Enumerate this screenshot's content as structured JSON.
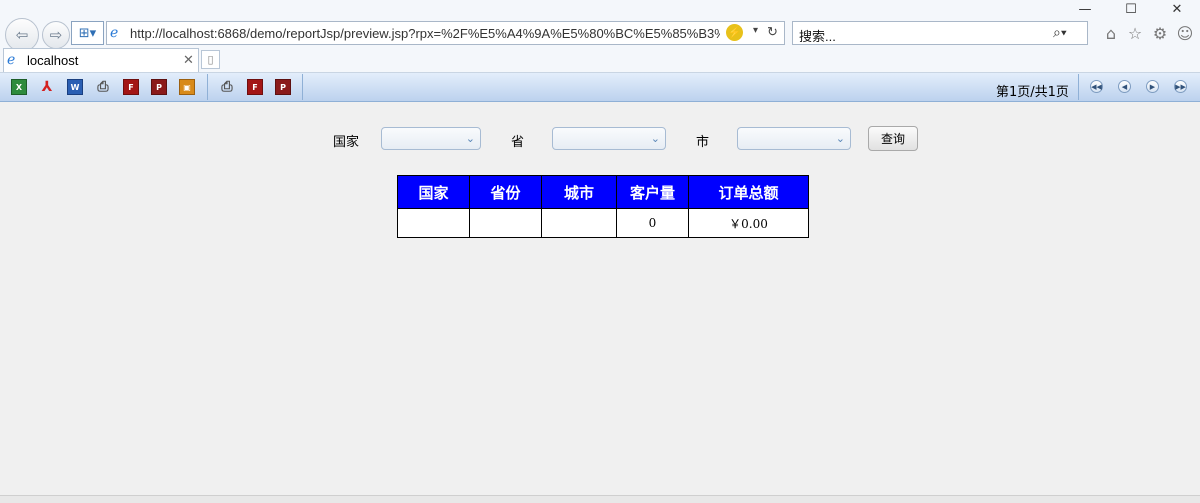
{
  "browser": {
    "url": "http://localhost:6868/demo/reportJsp/preview.jsp?rpx=%2F%E5%A4%9A%E5%80%BC%E5%85%B3%",
    "search_placeholder": "搜索...",
    "tab_title": "localhost"
  },
  "toolbar": {
    "page_info": "第1页/共1页"
  },
  "filters": {
    "country_label": "国家",
    "province_label": "省",
    "city_label": "市",
    "query_label": "查询"
  },
  "table": {
    "headers": [
      "国家",
      "省份",
      "城市",
      "客户量",
      "订单总额"
    ],
    "row": [
      "",
      "",
      "",
      "0",
      "￥0.00"
    ]
  }
}
